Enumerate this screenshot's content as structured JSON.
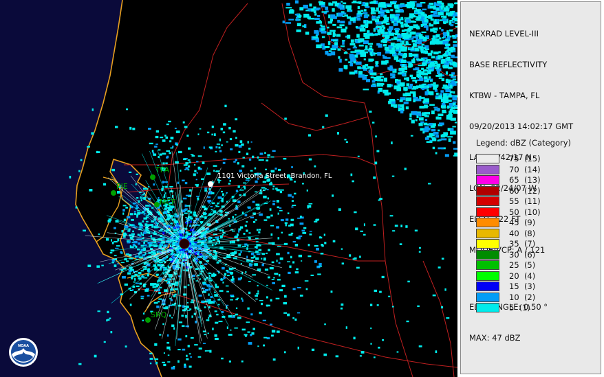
{
  "header": {
    "product": "NEXRAD LEVEL-III",
    "type": "BASE REFLECTIVITY",
    "station": "KTBW - TAMPA, FL",
    "datetime": "09/20/2013 14:02:17 GMT",
    "lat": "LAT: 27/42/17 N",
    "lon": "LON: 82/24/07 W",
    "elev": "ELEV: 122 FT",
    "mode": "MODE/VCP: A / 121",
    "elev_angle": "ELEV ANGLE: 0.50 °",
    "max": "MAX: 47 dBZ"
  },
  "legend": {
    "title": "Legend: dBZ (Category)",
    "entries": [
      {
        "label": "75  (15)",
        "color": "#ececec"
      },
      {
        "label": "70  (14)",
        "color": "#9a5ccc"
      },
      {
        "label": "65  (13)",
        "color": "#ff00e6"
      },
      {
        "label": "60  (12)",
        "color": "#b00000"
      },
      {
        "label": "55  (11)",
        "color": "#d40000"
      },
      {
        "label": "50  (10)",
        "color": "#ff0000"
      },
      {
        "label": "45  (9)",
        "color": "#ff8c00"
      },
      {
        "label": "40  (8)",
        "color": "#e8b800"
      },
      {
        "label": "35  (7)",
        "color": "#ffff00"
      },
      {
        "label": "30  (6)",
        "color": "#008c00"
      },
      {
        "label": "25  (5)",
        "color": "#00c000"
      },
      {
        "label": "20  (4)",
        "color": "#00ff00"
      },
      {
        "label": "15  (3)",
        "color": "#0000f6"
      },
      {
        "label": "10  (2)",
        "color": "#049df6"
      },
      {
        "label": "5  (1)",
        "color": "#00ecec"
      }
    ]
  },
  "map": {
    "sites": [
      {
        "label": "TPA"
      },
      {
        "label": "PIE"
      },
      {
        "label": "MCF"
      },
      {
        "label": "SRQ"
      }
    ],
    "address": "1101 Victoria Street, Brandon, FL",
    "logo": "NOAA",
    "colors": {
      "water": "#0a0a3a",
      "land": "#000000",
      "coast": "#e8a020",
      "roads": "#c02020"
    }
  }
}
